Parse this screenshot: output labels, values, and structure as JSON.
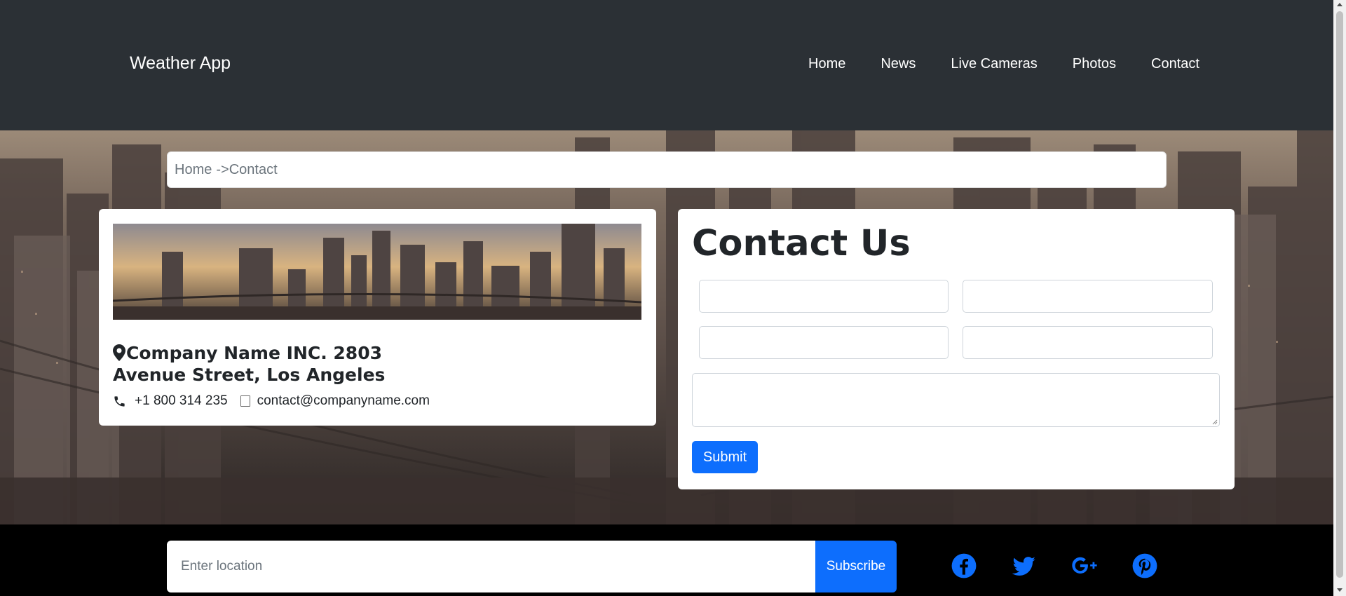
{
  "navbar": {
    "brand": "Weather App",
    "links": [
      "Home",
      "News",
      "Live Cameras",
      "Photos",
      "Contact"
    ]
  },
  "breadcrumb": {
    "home": "Home",
    "separator": "->",
    "current": "Contact"
  },
  "contact_card": {
    "address_line1": "Company Name INC. 2803",
    "address_line2": "Avenue Street, Los Angeles",
    "phone": "+1 800 314 235",
    "email": "contact@companyname.com"
  },
  "contact_form": {
    "title": "Contact Us",
    "submit_label": "Submit"
  },
  "footer": {
    "location_placeholder": "Enter location",
    "subscribe_label": "Subscribe",
    "social": [
      "facebook-icon",
      "twitter-icon",
      "google-plus-icon",
      "pinterest-icon"
    ]
  },
  "colors": {
    "navbar_bg": "#2b3035",
    "primary": "#0d6efd",
    "footer_bg": "#000000"
  }
}
